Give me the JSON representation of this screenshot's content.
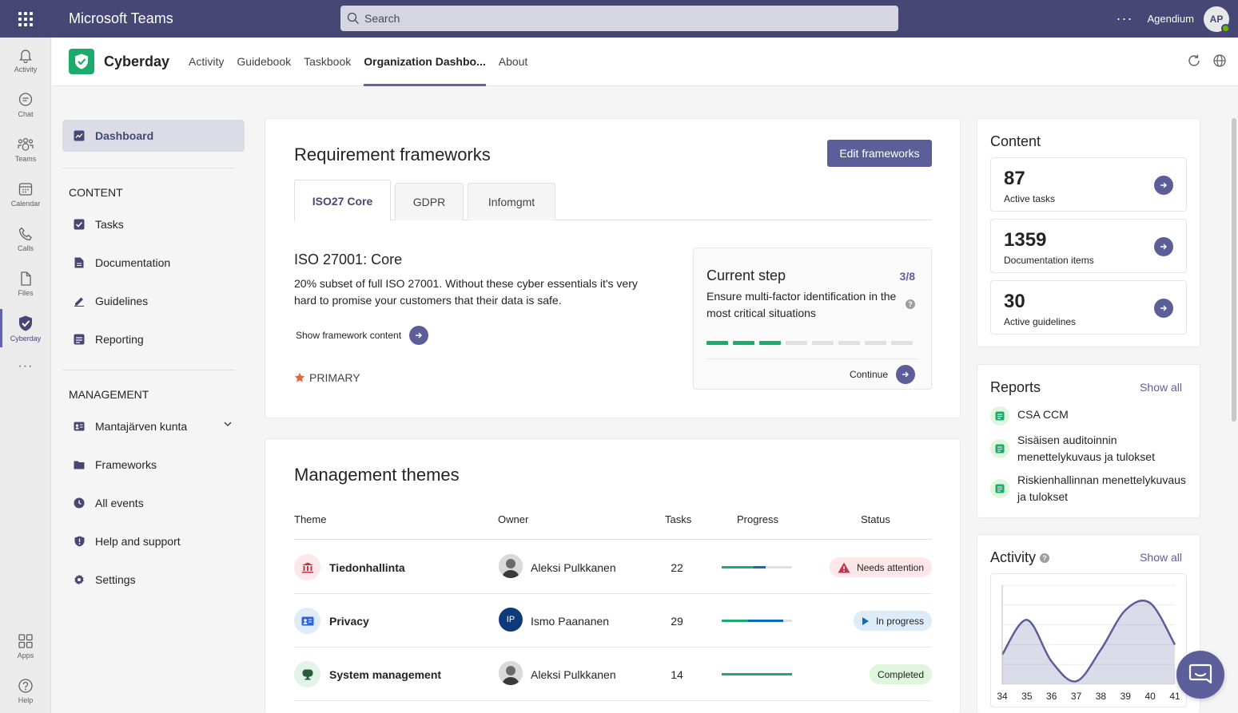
{
  "topbar": {
    "app_title": "Microsoft Teams",
    "search_placeholder": "Search",
    "more": "···",
    "tenant": "Agendium",
    "avatar_initials": "AP"
  },
  "rail": {
    "items": [
      {
        "label": "Activity",
        "icon": "bell-icon"
      },
      {
        "label": "Chat",
        "icon": "chat-icon"
      },
      {
        "label": "Teams",
        "icon": "teams-icon"
      },
      {
        "label": "Calendar",
        "icon": "calendar-icon"
      },
      {
        "label": "Calls",
        "icon": "phone-icon"
      },
      {
        "label": "Files",
        "icon": "file-icon"
      },
      {
        "label": "Cyberday",
        "icon": "shield-icon",
        "active": true
      }
    ],
    "more": "···",
    "bottom": [
      {
        "label": "Apps",
        "icon": "apps-icon"
      },
      {
        "label": "Help",
        "icon": "help-icon"
      }
    ]
  },
  "appheader": {
    "name": "Cyberday",
    "tabs": [
      "Activity",
      "Guidebook",
      "Taskbook",
      "Organization Dashbo...",
      "About"
    ],
    "active_tab": 3
  },
  "sidenav": {
    "active": "Dashboard",
    "content_heading": "CONTENT",
    "content_items": [
      "Tasks",
      "Documentation",
      "Guidelines",
      "Reporting"
    ],
    "management_heading": "MANAGEMENT",
    "management_items": [
      "Mantajärven kunta",
      "Frameworks",
      "All events",
      "Help and support",
      "Settings"
    ]
  },
  "frameworks": {
    "title": "Requirement frameworks",
    "edit_button": "Edit frameworks",
    "tabs": [
      "ISO27 Core",
      "GDPR",
      "Infomgmt"
    ],
    "active_tab": 0,
    "name": "ISO 27001: Core",
    "description": "20% subset of full ISO 27001. Without these cyber essentials it's very hard to promise your customers that their data is safe.",
    "show_content": "Show framework content",
    "primary_label": "PRIMARY",
    "current_step": {
      "title": "Current step",
      "count": "3/8",
      "completed": 3,
      "total": 8,
      "description": "Ensure multi-factor identification in the most critical situations",
      "help": "?",
      "continue": "Continue"
    }
  },
  "themes": {
    "title": "Management themes",
    "columns": [
      "Theme",
      "Owner",
      "Tasks",
      "Progress",
      "Status"
    ],
    "rows": [
      {
        "theme": "Tiedonhallinta",
        "owner": "Aleksi Pulkkanen",
        "owner_initials": "",
        "tasks": "22",
        "progress_done": 0.45,
        "progress_active": 0.18,
        "status": "Needs attention",
        "status_type": "attention"
      },
      {
        "theme": "Privacy",
        "owner": "Ismo Paananen",
        "owner_initials": "IP",
        "tasks": "29",
        "progress_done": 0.38,
        "progress_active": 0.5,
        "status": "In progress",
        "status_type": "progress"
      },
      {
        "theme": "System management",
        "owner": "Aleksi Pulkkanen",
        "owner_initials": "",
        "tasks": "14",
        "progress_done": 1.0,
        "progress_active": 0,
        "status": "Completed",
        "status_type": "completed"
      }
    ]
  },
  "content_card": {
    "title": "Content",
    "stats": [
      {
        "value": "87",
        "label": "Active tasks",
        "color": "#3dbfae"
      },
      {
        "value": "1359",
        "label": "Documentation items",
        "color": "#2b63d9"
      },
      {
        "value": "30",
        "label": "Active guidelines",
        "color": "#8b3fc7"
      }
    ]
  },
  "reports": {
    "title": "Reports",
    "show_all": "Show all",
    "items": [
      "CSA CCM",
      "Sisäisen auditoinnin menettelykuvaus ja tulokset",
      "Riskienhallinnan menettelykuvaus ja tulokset"
    ]
  },
  "activity": {
    "title": "Activity",
    "help": "?",
    "show_all": "Show all"
  },
  "chart_data": {
    "type": "area",
    "x": [
      34,
      35,
      36,
      37,
      38,
      39,
      40,
      41
    ],
    "y": [
      3,
      6.5,
      2.3,
      0.3,
      3.5,
      7.5,
      8.2,
      4.0
    ],
    "ylim": [
      0,
      10
    ],
    "tick_labels": [
      "34",
      "35",
      "36",
      "37",
      "38",
      "39",
      "40",
      "41"
    ],
    "color": "#5c5e99",
    "grid": true
  }
}
